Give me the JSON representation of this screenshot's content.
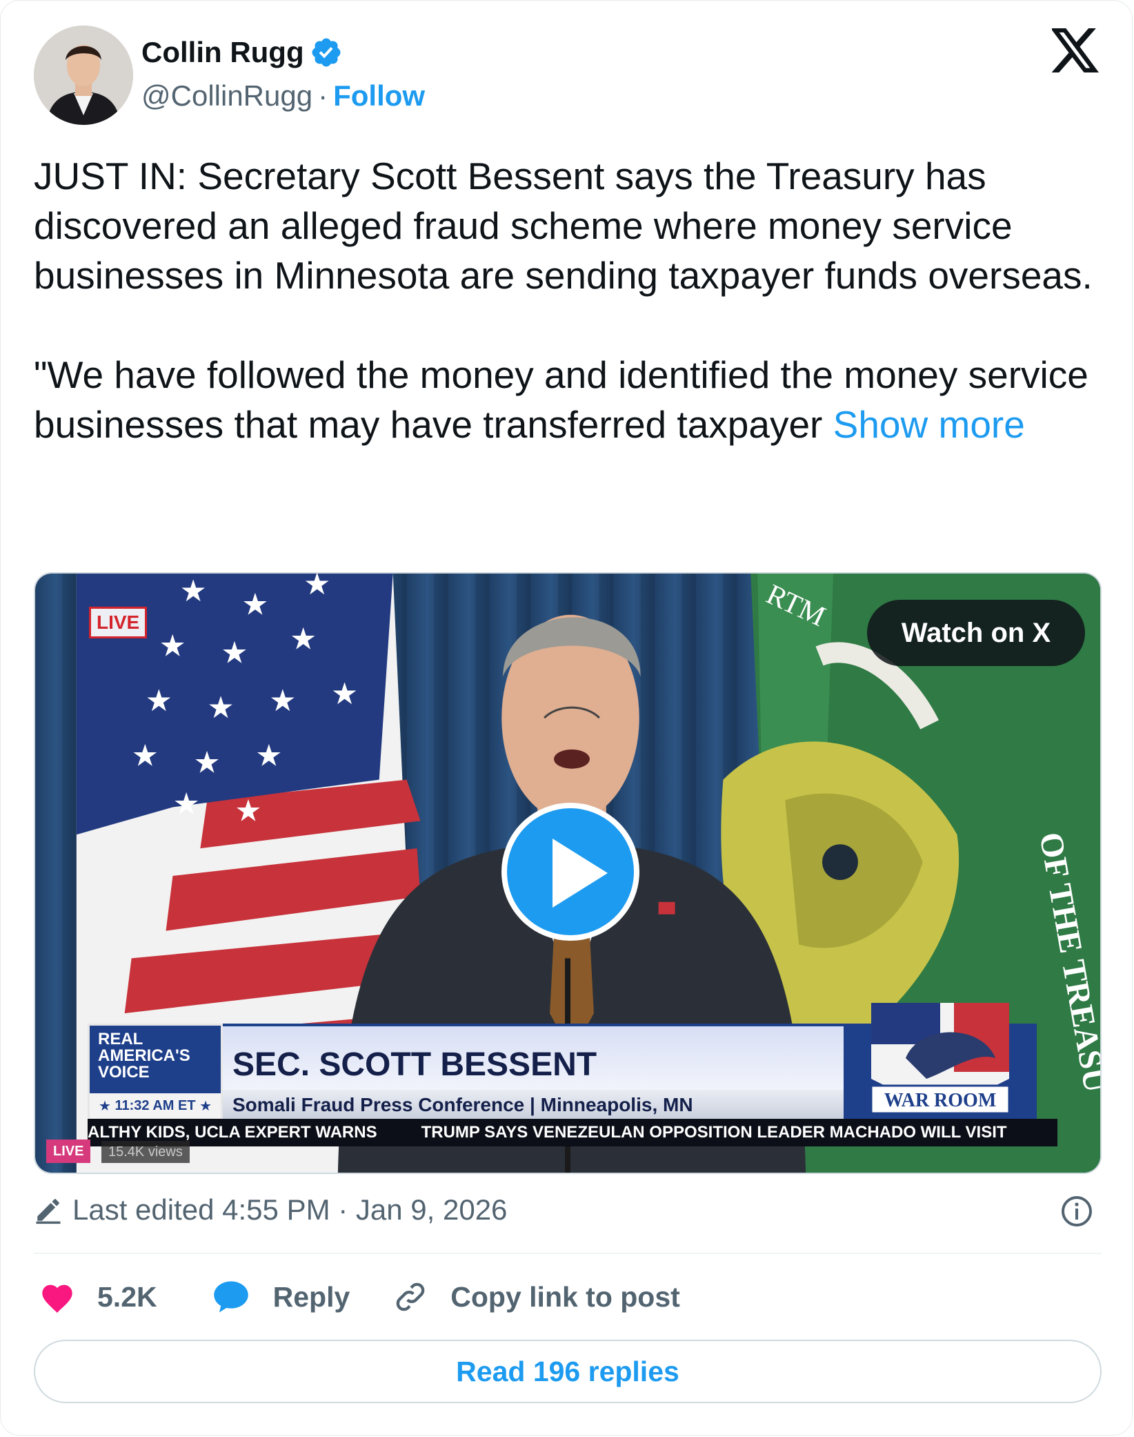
{
  "author": {
    "name": "Collin Rugg",
    "handle": "@CollinRugg",
    "separator": "·",
    "follow_label": "Follow"
  },
  "tweet": {
    "paragraph_1": "JUST IN: Secretary Scott Bessent says the Treasury has discovered an alleged fraud scheme where money service businesses in Minnesota are sending taxpayer funds overseas.",
    "paragraph_2": "\"We have followed the money and identified the money service businesses that may have transferred taxpayer",
    "show_more_label": "Show more"
  },
  "video": {
    "live_badge": "LIVE",
    "watch_label": "Watch on X",
    "lower_third": {
      "network": "REAL AMERICA'S VOICE",
      "time": "11:32 AM ET",
      "title": "SEC. SCOTT BESSENT",
      "subtitle": "Somali Fraud Press Conference | Minneapolis, MN",
      "show_logo": "WAR ROOM"
    },
    "ticker": [
      "ALTHY KIDS, UCLA EXPERT WARNS",
      "TRUMP SAYS VENEZEULAN OPPOSITION LEADER MACHADO WILL VISIT"
    ],
    "ticker_live": "LIVE",
    "views": "15.4K views",
    "flag_text_top": "RTM",
    "flag_text_side": "OF THE TREASU"
  },
  "meta": {
    "edited": "Last edited 4:55 PM · Jan 9, 2026"
  },
  "actions": {
    "likes": "5.2K",
    "reply_label": "Reply",
    "copy_label": "Copy link to post"
  },
  "read_replies_label": "Read 196 replies",
  "colors": {
    "accent": "#1d9bf0",
    "like": "#f91880",
    "text": "#0f1419",
    "muted": "#536471"
  },
  "icons": [
    "verified-badge-icon",
    "x-logo-icon",
    "play-icon",
    "pencil-icon",
    "info-icon",
    "heart-icon",
    "speech-bubble-icon",
    "link-icon"
  ]
}
